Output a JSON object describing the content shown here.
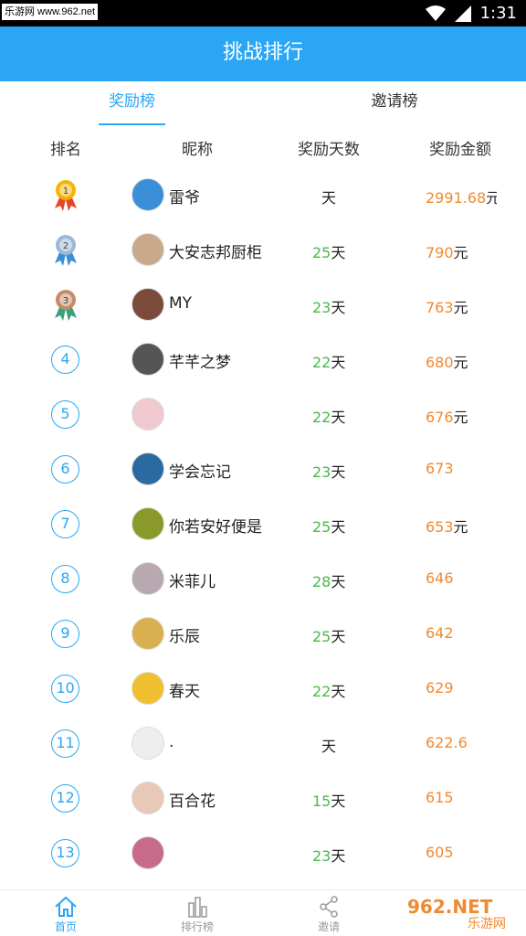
{
  "status_bar": {
    "watermark": "乐游网 www.962.net",
    "time": "1:31"
  },
  "header": {
    "title": "挑战排行"
  },
  "tabs": [
    {
      "label": "奖励榜",
      "active": true
    },
    {
      "label": "邀请榜",
      "active": false
    }
  ],
  "columns": {
    "rank": "排名",
    "nickname": "昵称",
    "days": "奖励天数",
    "amount": "奖励金额"
  },
  "rows": [
    {
      "rank": "1",
      "medal": "gold",
      "nickname": "雷爷",
      "days": "",
      "day_unit": "天",
      "amount": "2991.68",
      "amount_unit": "元"
    },
    {
      "rank": "2",
      "medal": "silver",
      "nickname": "大安志邦厨柜",
      "days": "25",
      "day_unit": "天",
      "amount": "790",
      "amount_unit": "元"
    },
    {
      "rank": "3",
      "medal": "bronze",
      "nickname": "MY",
      "days": "23",
      "day_unit": "天",
      "amount": "763",
      "amount_unit": "元"
    },
    {
      "rank": "4",
      "nickname": "芊芊之梦",
      "days": "22",
      "day_unit": "天",
      "amount": "680",
      "amount_unit": "元"
    },
    {
      "rank": "5",
      "nickname": "",
      "days": "22",
      "day_unit": "天",
      "amount": "676",
      "amount_unit": "元"
    },
    {
      "rank": "6",
      "nickname": "学会忘记",
      "days": "23",
      "day_unit": "天",
      "amount": "673",
      "amount_unit": ""
    },
    {
      "rank": "7",
      "nickname": "你若安好便是",
      "days": "25",
      "day_unit": "天",
      "amount": "653",
      "amount_unit": "元"
    },
    {
      "rank": "8",
      "nickname": "米菲儿",
      "days": "28",
      "day_unit": "天",
      "amount": "646",
      "amount_unit": ""
    },
    {
      "rank": "9",
      "nickname": "乐辰",
      "days": "25",
      "day_unit": "天",
      "amount": "642",
      "amount_unit": ""
    },
    {
      "rank": "10",
      "nickname": "春天",
      "days": "22",
      "day_unit": "天",
      "amount": "629",
      "amount_unit": ""
    },
    {
      "rank": "11",
      "nickname": ".",
      "days": "",
      "day_unit": "天",
      "amount": "622.6",
      "amount_unit": ""
    },
    {
      "rank": "12",
      "nickname": "百合花",
      "days": "15",
      "day_unit": "天",
      "amount": "615",
      "amount_unit": ""
    },
    {
      "rank": "13",
      "nickname": "",
      "days": "23",
      "day_unit": "天",
      "amount": "605",
      "amount_unit": ""
    }
  ],
  "bottom_nav": [
    {
      "label": "首页",
      "icon": "home-icon",
      "active": true
    },
    {
      "label": "排行榜",
      "icon": "bar-chart-icon",
      "active": false
    },
    {
      "label": "邀请",
      "icon": "share-icon",
      "active": false
    }
  ],
  "logo": {
    "text": "962.NET",
    "subtext": "乐游网"
  },
  "colors": {
    "primary": "#2aa6f4",
    "days_green": "#4cb84c",
    "amount_orange": "#f08a30",
    "status_bar": "#000000"
  }
}
